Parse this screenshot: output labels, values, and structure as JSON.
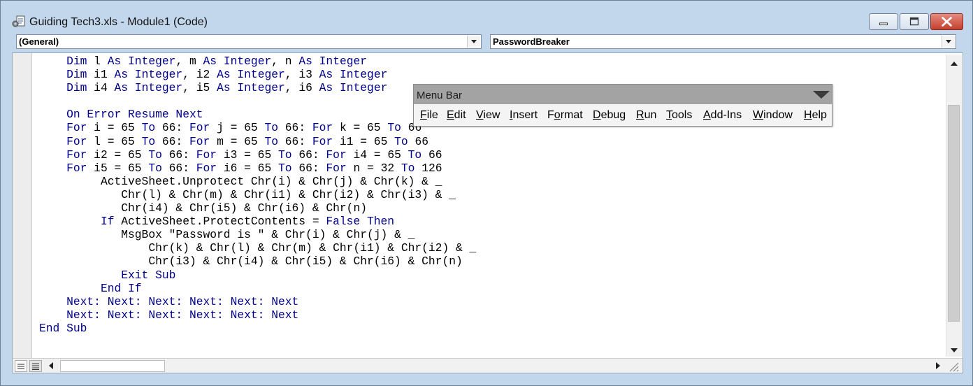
{
  "window": {
    "title": "Guiding Tech3.xls - Module1 (Code)",
    "icon": "vba-module-icon",
    "controls": [
      "minimize-icon",
      "maximize-icon",
      "close-icon"
    ]
  },
  "combos": {
    "object": "(General)",
    "procedure": "PasswordBreaker"
  },
  "code_lines": [
    {
      "indent": "    ",
      "parts": [
        {
          "t": "Dim",
          "k": true
        },
        {
          "t": " l "
        },
        {
          "t": "As Integer",
          "k": true
        },
        {
          "t": ", m "
        },
        {
          "t": "As Integer",
          "k": true
        },
        {
          "t": ", n "
        },
        {
          "t": "As Integer",
          "k": true
        }
      ]
    },
    {
      "indent": "    ",
      "parts": [
        {
          "t": "Dim",
          "k": true
        },
        {
          "t": " i1 "
        },
        {
          "t": "As Integer",
          "k": true
        },
        {
          "t": ", i2 "
        },
        {
          "t": "As Integer",
          "k": true
        },
        {
          "t": ", i3 "
        },
        {
          "t": "As Integer",
          "k": true
        }
      ]
    },
    {
      "indent": "    ",
      "parts": [
        {
          "t": "Dim",
          "k": true
        },
        {
          "t": " i4 "
        },
        {
          "t": "As Integer",
          "k": true
        },
        {
          "t": ", i5 "
        },
        {
          "t": "As Integer",
          "k": true
        },
        {
          "t": ", i6 "
        },
        {
          "t": "As Integer",
          "k": true
        }
      ]
    },
    {
      "indent": "",
      "parts": []
    },
    {
      "indent": "    ",
      "parts": [
        {
          "t": "On Error Resume Next",
          "k": true
        }
      ]
    },
    {
      "indent": "    ",
      "parts": [
        {
          "t": "For",
          "k": true
        },
        {
          "t": " i = 65 "
        },
        {
          "t": "To",
          "k": true
        },
        {
          "t": " 66: "
        },
        {
          "t": "For",
          "k": true
        },
        {
          "t": " j = 65 "
        },
        {
          "t": "To",
          "k": true
        },
        {
          "t": " 66: "
        },
        {
          "t": "For",
          "k": true
        },
        {
          "t": " k = 65 "
        },
        {
          "t": "To",
          "k": true
        },
        {
          "t": " 66"
        }
      ]
    },
    {
      "indent": "    ",
      "parts": [
        {
          "t": "For",
          "k": true
        },
        {
          "t": " l = 65 "
        },
        {
          "t": "To",
          "k": true
        },
        {
          "t": " 66: "
        },
        {
          "t": "For",
          "k": true
        },
        {
          "t": " m = 65 "
        },
        {
          "t": "To",
          "k": true
        },
        {
          "t": " 66: "
        },
        {
          "t": "For",
          "k": true
        },
        {
          "t": " i1 = 65 "
        },
        {
          "t": "To",
          "k": true
        },
        {
          "t": " 66"
        }
      ]
    },
    {
      "indent": "    ",
      "parts": [
        {
          "t": "For",
          "k": true
        },
        {
          "t": " i2 = 65 "
        },
        {
          "t": "To",
          "k": true
        },
        {
          "t": " 66: "
        },
        {
          "t": "For",
          "k": true
        },
        {
          "t": " i3 = 65 "
        },
        {
          "t": "To",
          "k": true
        },
        {
          "t": " 66: "
        },
        {
          "t": "For",
          "k": true
        },
        {
          "t": " i4 = 65 "
        },
        {
          "t": "To",
          "k": true
        },
        {
          "t": " 66"
        }
      ]
    },
    {
      "indent": "    ",
      "parts": [
        {
          "t": "For",
          "k": true
        },
        {
          "t": " i5 = 65 "
        },
        {
          "t": "To",
          "k": true
        },
        {
          "t": " 66: "
        },
        {
          "t": "For",
          "k": true
        },
        {
          "t": " i6 = 65 "
        },
        {
          "t": "To",
          "k": true
        },
        {
          "t": " 66: "
        },
        {
          "t": "For",
          "k": true
        },
        {
          "t": " n = 32 "
        },
        {
          "t": "To",
          "k": true
        },
        {
          "t": " 126"
        }
      ]
    },
    {
      "indent": "         ",
      "parts": [
        {
          "t": "ActiveSheet.Unprotect Chr(i) & Chr(j) & Chr(k) & _"
        }
      ]
    },
    {
      "indent": "            ",
      "parts": [
        {
          "t": "Chr(l) & Chr(m) & Chr(i1) & Chr(i2) & Chr(i3) & _"
        }
      ]
    },
    {
      "indent": "            ",
      "parts": [
        {
          "t": "Chr(i4) & Chr(i5) & Chr(i6) & Chr(n)"
        }
      ]
    },
    {
      "indent": "         ",
      "parts": [
        {
          "t": "If",
          "k": true
        },
        {
          "t": " ActiveSheet.ProtectContents = "
        },
        {
          "t": "False Then",
          "k": true
        }
      ]
    },
    {
      "indent": "            ",
      "parts": [
        {
          "t": "MsgBox \"Password is \" & Chr(i) & Chr(j) & _"
        }
      ]
    },
    {
      "indent": "                ",
      "parts": [
        {
          "t": "Chr(k) & Chr(l) & Chr(m) & Chr(i1) & Chr(i2) & _"
        }
      ]
    },
    {
      "indent": "                ",
      "parts": [
        {
          "t": "Chr(i3) & Chr(i4) & Chr(i5) & Chr(i6) & Chr(n)"
        }
      ]
    },
    {
      "indent": "            ",
      "parts": [
        {
          "t": "Exit Sub",
          "k": true
        }
      ]
    },
    {
      "indent": "         ",
      "parts": [
        {
          "t": "End If",
          "k": true
        }
      ]
    },
    {
      "indent": "    ",
      "parts": [
        {
          "t": "Next: Next: Next: Next: Next: Next",
          "k": true
        }
      ]
    },
    {
      "indent": "    ",
      "parts": [
        {
          "t": "Next: Next: Next: Next: Next: Next",
          "k": true
        }
      ]
    },
    {
      "indent": "",
      "parts": [
        {
          "t": "End Sub",
          "k": true
        }
      ]
    }
  ],
  "menu_bar": {
    "title": "Menu Bar",
    "items": [
      {
        "label": "File",
        "accel": "F"
      },
      {
        "label": "Edit",
        "accel": "E"
      },
      {
        "label": "View",
        "accel": "V"
      },
      {
        "label": "Insert",
        "accel": "I"
      },
      {
        "label": "Format",
        "accel": "o"
      },
      {
        "label": "Debug",
        "accel": "D"
      },
      {
        "label": "Run",
        "accel": "R"
      },
      {
        "label": "Tools",
        "accel": "T"
      },
      {
        "label": "Add-Ins",
        "accel": "A"
      },
      {
        "label": "Window",
        "accel": "W"
      },
      {
        "label": "Help",
        "accel": "H"
      }
    ]
  },
  "colors": {
    "keyword": "#00008b",
    "text": "#000000",
    "window_frame": "#c3d7ec",
    "menu_caption": "#a3a3a3"
  }
}
